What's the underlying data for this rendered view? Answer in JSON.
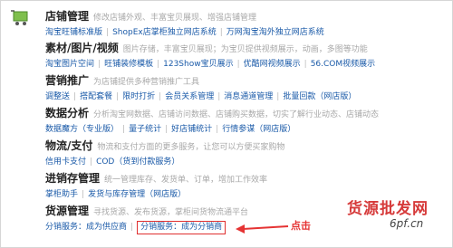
{
  "sections": [
    {
      "title": "店铺管理",
      "desc": "修改店铺外观、丰富宝贝展现、增强店铺管理",
      "links": [
        "淘宝旺铺标准版",
        "ShopEx店掌柜独立网店系统",
        "万网淘宝淘外独立网店系统"
      ]
    },
    {
      "title": "素材/图片/视频",
      "desc": "图片存储，丰富宝贝展现；为宝贝提供视频展示，动画，多图等功能",
      "links": [
        "淘宝图片空间",
        "旺铺装修模板",
        "123Show宝贝展示",
        "优酷网视频展示",
        "56.COM视频展示"
      ]
    },
    {
      "title": "营销推广",
      "desc": "为店铺提供多种营销推广工具",
      "links": [
        "调整送",
        "搭配套餐",
        "限时打折",
        "会员关系管理",
        "消息通道管理",
        "批量回款（网店版）"
      ]
    },
    {
      "title": "数据分析",
      "desc": "分析淘宝网数据、店铺访问数据、店铺购买数据，切实了解行业动态、店铺动态",
      "links": [
        "数据魔方（专业版）",
        "量子统计",
        "好店铺统计",
        "行情参谋（网店版）"
      ]
    },
    {
      "title": "物流/支付",
      "desc": "物流和支付方面的更多服务，让您可以方便买家购物",
      "links": [
        "信用卡支付",
        "COD（货到付款服务）"
      ]
    },
    {
      "title": "进销存管理",
      "desc": "统一管理库存、发货单、订单，增加工作效率",
      "links": [
        "掌柜助手",
        "发货与库存管理（网店版）"
      ]
    },
    {
      "title": "货源管理",
      "desc": "寻找货源、发布货源，掌柜间货物流通平台",
      "links": [
        "分销服务：成为供应商",
        "分销服务：成为分销商"
      ]
    }
  ],
  "annotation": "点击",
  "watermark": {
    "text": "货源批发网",
    "site": "6pf.cn"
  },
  "colors": {
    "link": "#1a5aa8",
    "highlight": "#e03030",
    "annotation": "#e53333"
  },
  "icons": {
    "header": "shopping-cart-icon"
  }
}
